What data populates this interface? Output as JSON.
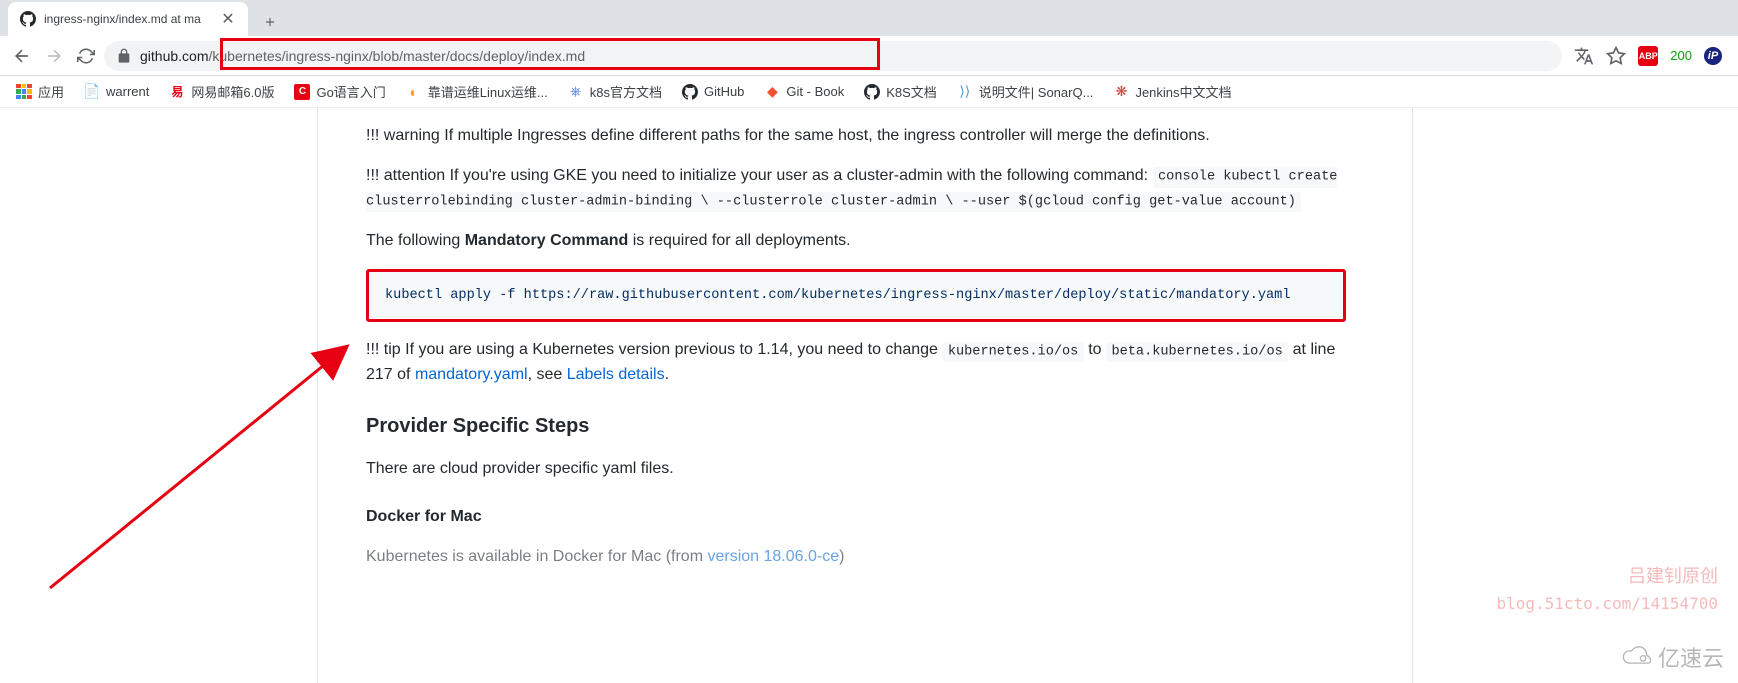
{
  "tab": {
    "title": "ingress-nginx/index.md at ma"
  },
  "url": {
    "host": "github.com",
    "path": "/kubernetes/ingress-nginx/blob/master/docs/deploy/index.md"
  },
  "toolbar_right": {
    "count": "200"
  },
  "apps_label": "应用",
  "bookmarks": [
    {
      "icon": "📄",
      "icon_color": "#4285f4",
      "label": "warrent"
    },
    {
      "icon": "易",
      "icon_color": "#e60012",
      "label": "网易邮箱6.0版"
    },
    {
      "icon": "C",
      "icon_color": "#e60012",
      "label": "Go语言入门"
    },
    {
      "icon": "◐",
      "icon_color": "#ff9800",
      "label": "靠谱运维Linux运维..."
    },
    {
      "icon": "⎈",
      "icon_color": "#326ce5",
      "label": "k8s官方文档"
    },
    {
      "icon": "github",
      "icon_color": "#24292e",
      "label": "GitHub"
    },
    {
      "icon": "◆",
      "icon_color": "#f05133",
      "label": "Git - Book"
    },
    {
      "icon": "github",
      "icon_color": "#24292e",
      "label": "K8S文档"
    },
    {
      "icon": "⟩⟩",
      "icon_color": "#4e9bcd",
      "label": "说明文件| SonarQ..."
    },
    {
      "icon": "❋",
      "icon_color": "#d33833",
      "label": "Jenkins中文文档"
    }
  ],
  "article": {
    "warning": "!!! warning If multiple Ingresses define different paths for the same host, the ingress controller will merge the definitions.",
    "attention_text": "!!! attention If you're using GKE you need to initialize your user as a cluster-admin with the following command: ",
    "attention_code": "console kubectl create clusterrolebinding cluster-admin-binding \\ --clusterrole cluster-admin \\ --user $(gcloud config get-value account)",
    "mandatory_pre": "The following ",
    "mandatory_strong": "Mandatory Command",
    "mandatory_post": " is required for all deployments.",
    "apply_cmd": "kubectl apply -f https://raw.githubusercontent.com/kubernetes/ingress-nginx/master/deploy/static/mandatory.yaml",
    "tip_pre": "!!! tip If you are using a Kubernetes version previous to 1.14, you need to change ",
    "tip_code1": "kubernetes.io/os",
    "tip_mid": " to ",
    "tip_code2": "beta.kubernetes.io/os",
    "tip_line": " at line 217 of ",
    "tip_link1": "mandatory.yaml",
    "tip_see": ", see ",
    "tip_link2": "Labels details",
    "tip_end": ".",
    "h3_provider": "Provider Specific Steps",
    "provider_text": "There are cloud provider specific yaml files.",
    "h4_docker": "Docker for Mac",
    "docker_pre": "Kubernetes is available in Docker for Mac (from ",
    "docker_link": "version 18.06.0-ce",
    "docker_post": ")"
  },
  "watermark": {
    "author": "吕建钊原创",
    "blog": "blog.51cto.com/14154700",
    "brand": "亿速云"
  }
}
